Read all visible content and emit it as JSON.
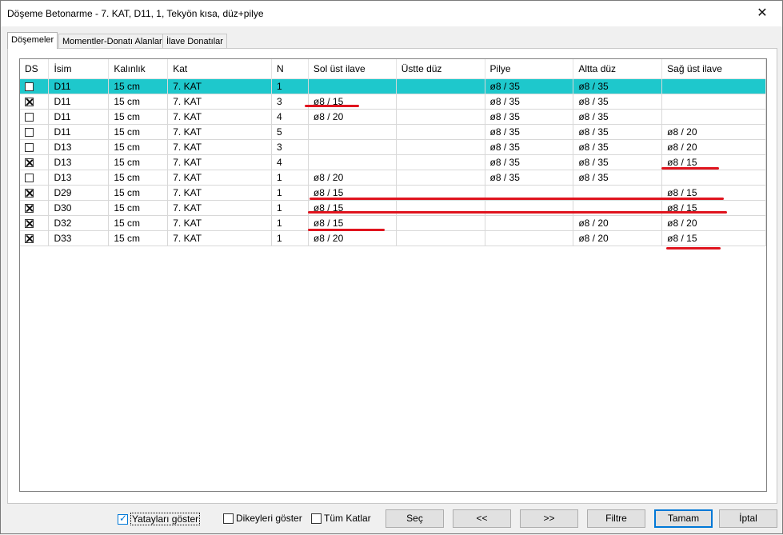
{
  "window": {
    "title": "Döşeme Betonarme - 7. KAT, D11, 1, Tekyön kısa, düz+pilye",
    "close_glyph": "✕"
  },
  "tabs": [
    {
      "label": "Döşemeler",
      "active": true
    },
    {
      "label": "Momentler-Donatı Alanları",
      "active": false
    },
    {
      "label": "İlave Donatılar",
      "active": false
    }
  ],
  "table": {
    "columns": [
      "DS",
      "İsim",
      "Kalınlık",
      "Kat",
      "N",
      "Sol üst ilave",
      "Üstte düz",
      "Pilye",
      "Altta düz",
      "Sağ üst ilave"
    ],
    "rows": [
      {
        "ds": false,
        "isim": "D11",
        "kalinlik": "15 cm",
        "kat": "7. KAT",
        "n": "1",
        "sol": "",
        "ustte": "",
        "pilye": "ø8 / 35",
        "altta": "ø8 / 35",
        "sag": "",
        "selected": true
      },
      {
        "ds": true,
        "isim": "D11",
        "kalinlik": "15 cm",
        "kat": "7. KAT",
        "n": "3",
        "sol": "ø8 / 15",
        "ustte": "",
        "pilye": "ø8 / 35",
        "altta": "ø8 / 35",
        "sag": ""
      },
      {
        "ds": false,
        "isim": "D11",
        "kalinlik": "15 cm",
        "kat": "7. KAT",
        "n": "4",
        "sol": "ø8 / 20",
        "ustte": "",
        "pilye": "ø8 / 35",
        "altta": "ø8 / 35",
        "sag": ""
      },
      {
        "ds": false,
        "isim": "D11",
        "kalinlik": "15 cm",
        "kat": "7. KAT",
        "n": "5",
        "sol": "",
        "ustte": "",
        "pilye": "ø8 / 35",
        "altta": "ø8 / 35",
        "sag": "ø8 / 20"
      },
      {
        "ds": false,
        "isim": "D13",
        "kalinlik": "15 cm",
        "kat": "7. KAT",
        "n": "3",
        "sol": "",
        "ustte": "",
        "pilye": "ø8 / 35",
        "altta": "ø8 / 35",
        "sag": "ø8 / 20"
      },
      {
        "ds": true,
        "isim": "D13",
        "kalinlik": "15 cm",
        "kat": "7. KAT",
        "n": "4",
        "sol": "",
        "ustte": "",
        "pilye": "ø8 / 35",
        "altta": "ø8 / 35",
        "sag": "ø8 / 15"
      },
      {
        "ds": false,
        "isim": "D13",
        "kalinlik": "15 cm",
        "kat": "7. KAT",
        "n": "1",
        "sol": "ø8 / 20",
        "ustte": "",
        "pilye": "ø8 / 35",
        "altta": "ø8 / 35",
        "sag": ""
      },
      {
        "ds": true,
        "isim": "D29",
        "kalinlik": "15 cm",
        "kat": "7. KAT",
        "n": "1",
        "sol": "ø8 / 15",
        "ustte": "",
        "pilye": "",
        "altta": "",
        "sag": "ø8 / 15"
      },
      {
        "ds": true,
        "isim": "D30",
        "kalinlik": "15 cm",
        "kat": "7. KAT",
        "n": "1",
        "sol": "ø8 / 15",
        "ustte": "",
        "pilye": "",
        "altta": "",
        "sag": "ø8 / 15"
      },
      {
        "ds": true,
        "isim": "D32",
        "kalinlik": "15 cm",
        "kat": "7. KAT",
        "n": "1",
        "sol": "ø8 / 15",
        "ustte": "",
        "pilye": "",
        "altta": "ø8 / 20",
        "sag": "ø8 / 20"
      },
      {
        "ds": true,
        "isim": "D33",
        "kalinlik": "15 cm",
        "kat": "7. KAT",
        "n": "1",
        "sol": "ø8 / 20",
        "ustte": "",
        "pilye": "",
        "altta": "ø8 / 20",
        "sag": "ø8 / 15"
      }
    ]
  },
  "options": {
    "yataylari": {
      "label": "Yatayları göster",
      "checked": true
    },
    "dikeyleri": {
      "label": "Dikeyleri göster",
      "checked": false
    },
    "tum_katlar": {
      "label": "Tüm Katlar",
      "checked": false
    }
  },
  "buttons": {
    "sec": "Seç",
    "prev": "<<",
    "next": ">>",
    "filtre": "Filtre",
    "tamam": "Tamam",
    "iptal": "İptal"
  },
  "colors": {
    "selected_row": "#1ec8cc",
    "annotation": "#e0141e",
    "default_button_border": "#0078d7"
  }
}
